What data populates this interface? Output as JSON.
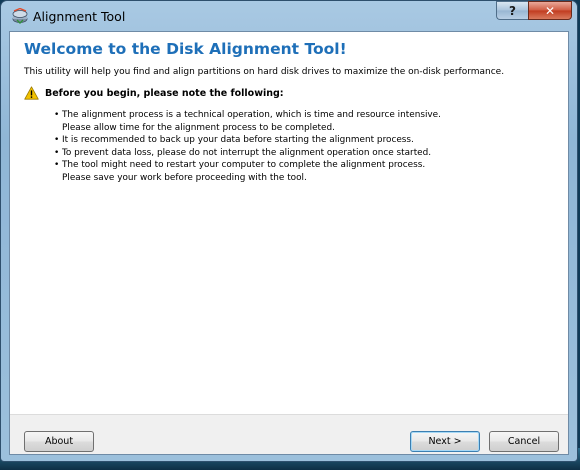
{
  "window": {
    "title": "Alignment Tool",
    "help_glyph": "?",
    "close_glyph": "✕"
  },
  "content": {
    "heading": "Welcome to the Disk Alignment Tool!",
    "intro": "This utility will help you find and align partitions on hard disk drives to maximize the on-disk performance.",
    "warning": "Before you begin, please note the following:",
    "bullet_glyph": "•",
    "notes": [
      [
        "The alignment process is a technical operation, which is time and resource intensive.",
        "Please allow time for the alignment process to be completed."
      ],
      [
        "It is recommended to back up your data before starting the alignment process."
      ],
      [
        "To prevent data loss, please do not interrupt the alignment operation once started."
      ],
      [
        "The tool might need to restart your computer to complete the alignment process.",
        "Please save your work before proceeding with the tool."
      ]
    ]
  },
  "buttons": {
    "about": "About",
    "next": "Next >",
    "cancel": "Cancel"
  },
  "icons": {
    "app": "disk-alignment-app-icon",
    "warning": "warning-triangle-icon",
    "help": "help-icon",
    "close": "close-icon"
  },
  "colors": {
    "heading": "#1e6fb8",
    "close_button": "#c13b1f",
    "warning": "#f2c200"
  }
}
